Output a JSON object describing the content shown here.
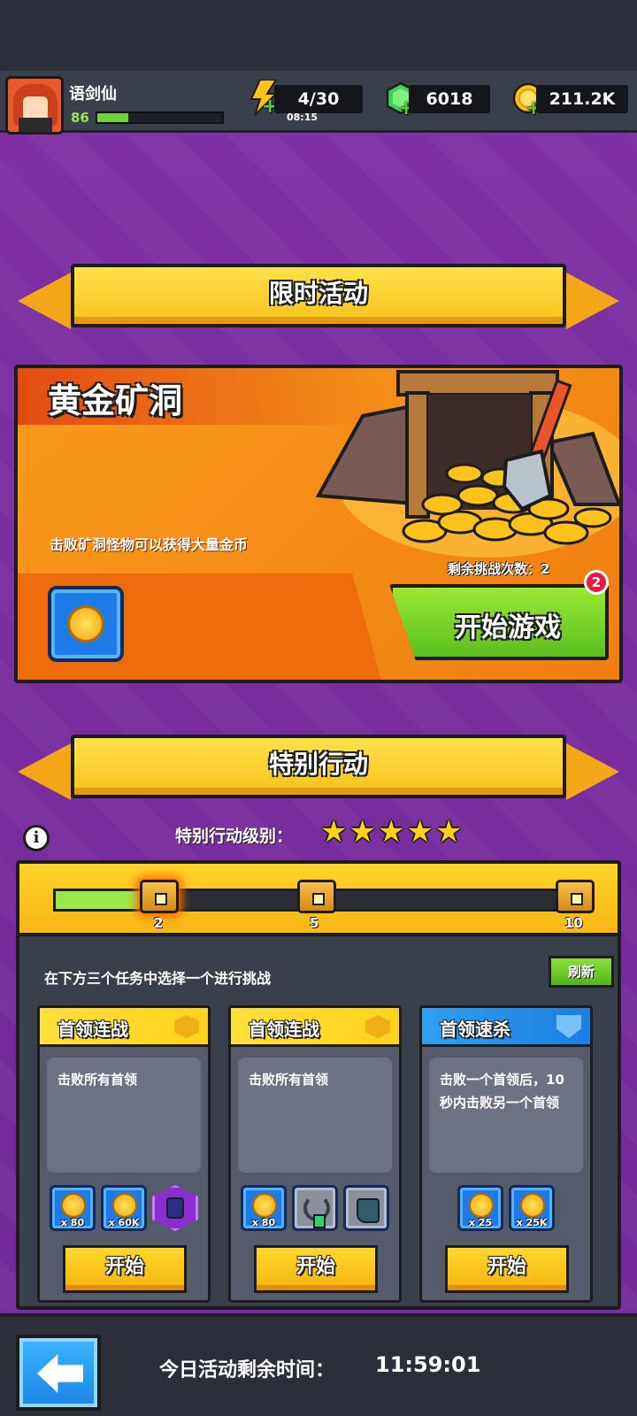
{
  "player": {
    "name": "语剑仙",
    "level": "86",
    "xp_fraction": 0.25
  },
  "resources": {
    "energy": {
      "value": "4/30",
      "timer": "08:15",
      "icon": "lightning-icon"
    },
    "gems": {
      "value": "6018",
      "icon": "gem-icon"
    },
    "coins": {
      "value": "211.2K",
      "icon": "coin-icon"
    }
  },
  "limited_event": {
    "banner_title": "限时活动",
    "card_title": "黄金矿洞",
    "description": "击败矿洞怪物可以获得大量金币",
    "remaining_label": "剩余挑战次数：2",
    "start_label": "开始游戏",
    "badge_count": "2"
  },
  "special_ops": {
    "banner_title": "特别行动",
    "rank_label": "特别行动级别：",
    "stars": [
      "★",
      "★",
      "★",
      "★",
      "★"
    ],
    "progress_fraction": 0.17,
    "milestones": [
      "2",
      "5",
      "10"
    ],
    "hint": "在下方三个任务中选择一个进行挑战",
    "refresh_label": "刷新",
    "missions": [
      {
        "title": "首领连战",
        "theme": "yellow",
        "description": "击败所有首领",
        "rewards": [
          {
            "kind": "coin",
            "qty": "x 80"
          },
          {
            "kind": "coin",
            "qty": "x 60K"
          },
          {
            "kind": "bag",
            "qty": ""
          }
        ],
        "start_label": "开始"
      },
      {
        "title": "首领连战",
        "theme": "yellow",
        "description": "击败所有首领",
        "rewards": [
          {
            "kind": "coin",
            "qty": "x 80"
          },
          {
            "kind": "necklace",
            "qty": ""
          },
          {
            "kind": "boot",
            "qty": ""
          }
        ],
        "start_label": "开始"
      },
      {
        "title": "首领速杀",
        "theme": "blue",
        "description": "击败一个首领后，10秒内击败另一个首领",
        "rewards": [
          {
            "kind": "coin",
            "qty": "x 25"
          },
          {
            "kind": "coin",
            "qty": "x 25K"
          }
        ],
        "start_label": "开始"
      }
    ]
  },
  "footer": {
    "time_label": "今日活动剩余时间：",
    "time_value": "11:59:01"
  },
  "colors": {
    "background": "#7a2da0",
    "accent_yellow": "#ffd21a",
    "accent_green": "#6fd23a",
    "accent_blue": "#1d7ae6"
  }
}
